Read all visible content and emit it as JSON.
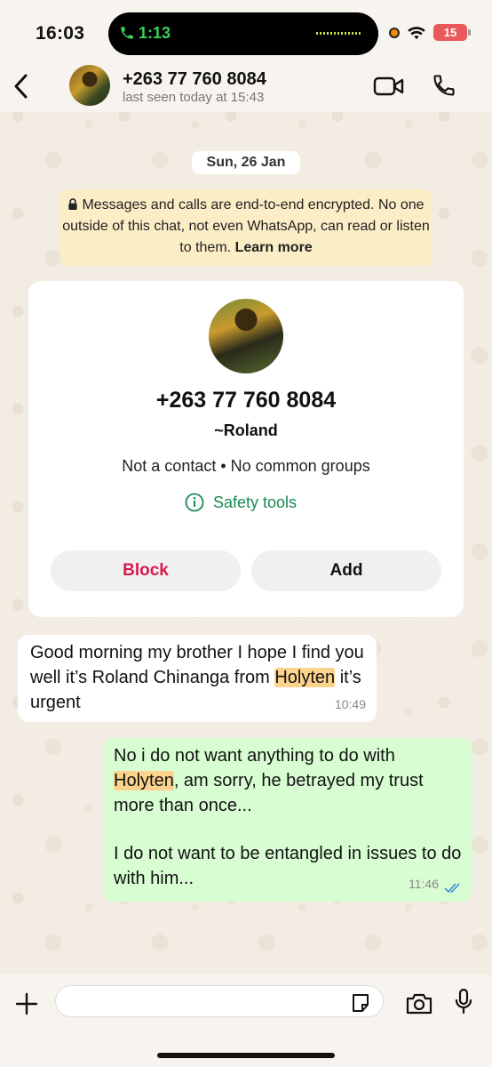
{
  "status_bar": {
    "time": "16:03",
    "call_duration": "1:13",
    "battery": "15"
  },
  "header": {
    "title": "+263 77 760 8084",
    "subtitle": "last seen today at 15:43"
  },
  "chat": {
    "date": "Sun, 26 Jan",
    "encryption": {
      "text": "Messages and calls are end-to-end encrypted. No one outside of this chat, not even WhatsApp, can read or listen to them.",
      "link": "Learn more"
    },
    "contact_card": {
      "phone": "+263 77 760 8084",
      "name": "~Roland",
      "meta": "Not a contact • No common groups",
      "safety_tools": "Safety tools",
      "block_label": "Block",
      "add_label": "Add"
    },
    "messages": [
      {
        "direction": "incoming",
        "before": "Good morning my brother I hope I find you well it’s Roland Chinanga from ",
        "highlight": "Holyten",
        "after": " it’s urgent",
        "time": "10:49"
      },
      {
        "direction": "outgoing",
        "before": "No i do not want anything to do with ",
        "highlight": "Holyten",
        "after": ", am sorry, he betrayed my trust more than once...",
        "paragraph2": "I do not want to be entangled in issues to do with him...",
        "time": "11:46",
        "status": "read"
      }
    ]
  },
  "input_bar": {
    "placeholder": ""
  },
  "colors": {
    "accent_green": "#1a8a52",
    "block_red": "#d9184b",
    "outgoing_bubble": "#d9fdd3",
    "encryption_bg": "#fbedc6",
    "highlight": "#fbd38d",
    "read_ticks": "#3b8fe0"
  }
}
